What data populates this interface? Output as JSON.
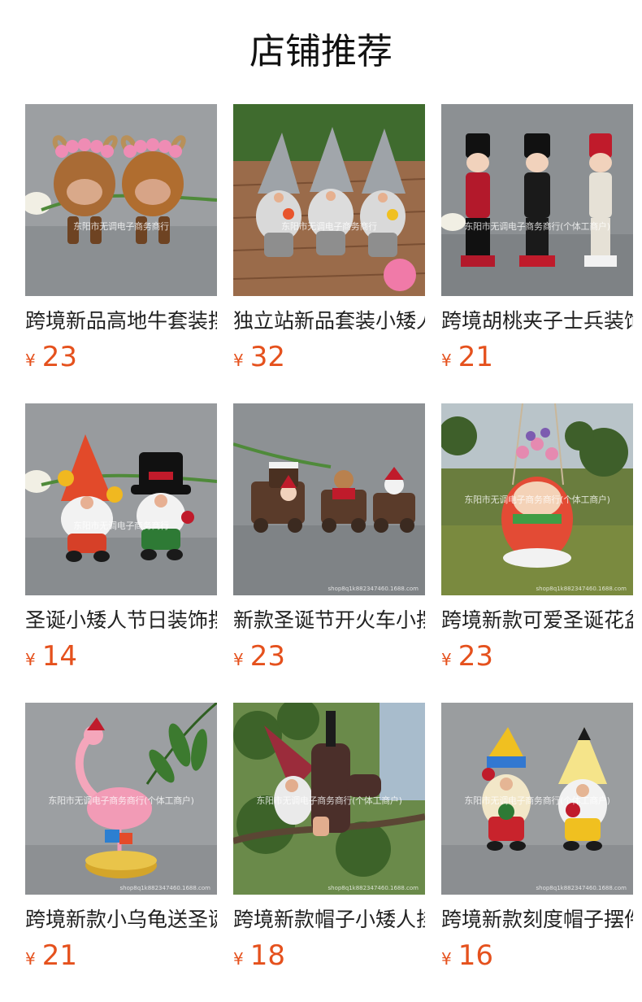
{
  "header": {
    "title": "店铺推荐"
  },
  "colors": {
    "price": "#e5511d",
    "title": "#111111",
    "name": "#222222"
  },
  "products": [
    {
      "name": "跨境新品高地牛套装摆件",
      "currency": "¥",
      "price": "23",
      "watermark": "东阳市无调电子商务商行",
      "shop_mark": "",
      "image_icon": "highland-cow-figurines"
    },
    {
      "name": "独立站新品套装小矮人",
      "currency": "¥",
      "price": "32",
      "watermark": "东阳市无调电子商务商行",
      "shop_mark": "",
      "image_icon": "gnome-trio-figurines"
    },
    {
      "name": "跨境胡桃夹子士兵装饰",
      "currency": "¥",
      "price": "21",
      "watermark": "东阳市无调电子商务商行(个体工商户)",
      "shop_mark": "",
      "image_icon": "nutcracker-soldiers"
    },
    {
      "name": "圣诞小矮人节日装饰摆件",
      "currency": "¥",
      "price": "14",
      "watermark": "东阳市无调电子商务商行",
      "shop_mark": "",
      "image_icon": "christmas-gnome-pair"
    },
    {
      "name": "新款圣诞节开火车小摆件",
      "currency": "¥",
      "price": "23",
      "watermark": "",
      "shop_mark": "shop8q1k882347460.1688.com",
      "image_icon": "christmas-train-figurines"
    },
    {
      "name": "跨境新款可爱圣诞花盆",
      "currency": "¥",
      "price": "23",
      "watermark": "东阳市无调电子商务商行(个体工商户)",
      "shop_mark": "shop8q1k882347460.1688.com",
      "image_icon": "snowman-hanging-planter"
    },
    {
      "name": "跨境新款小乌龟送圣诞礼物",
      "currency": "¥",
      "price": "21",
      "watermark": "东阳市无调电子商务商行(个体工商户)",
      "shop_mark": "shop8q1k882347460.1688.com",
      "image_icon": "flamingo-figurine"
    },
    {
      "name": "跨境新款帽子小矮人挂件",
      "currency": "¥",
      "price": "18",
      "watermark": "东阳市无调电子商务商行(个体工商户)",
      "shop_mark": "shop8q1k882347460.1688.com",
      "image_icon": "tree-hugger-gnome"
    },
    {
      "name": "跨境新款刻度帽子摆件",
      "currency": "¥",
      "price": "16",
      "watermark": "东阳市无调电子商务商行(个体工商户)",
      "shop_mark": "shop8q1k882347460.1688.com",
      "image_icon": "pencil-hat-gnomes"
    }
  ]
}
